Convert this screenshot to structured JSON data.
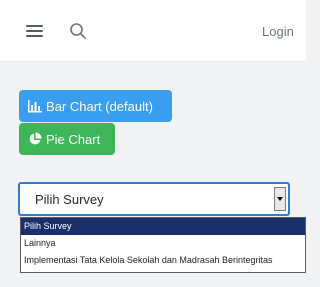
{
  "navbar": {
    "login_label": "Login"
  },
  "buttons": {
    "bar_chart_label": "Bar Chart (default)",
    "pie_chart_label": "Pie Chart"
  },
  "survey_select": {
    "selected": "Pilih Survey",
    "options": [
      "Pilih Survey",
      "Lainnya",
      "Implementasi Tata Kelola Sekolah dan Madrasah Berintegritas"
    ]
  },
  "colors": {
    "bar_button": "#3a9ef0",
    "pie_button": "#3fb55a",
    "selected_option": "#1b2f6b",
    "select_border": "#2d7fd6"
  },
  "icons": {
    "menu": "hamburger-icon",
    "search": "search-icon",
    "bar": "bar-chart-icon",
    "pie": "pie-chart-icon",
    "dropdown": "chevron-down-icon"
  }
}
